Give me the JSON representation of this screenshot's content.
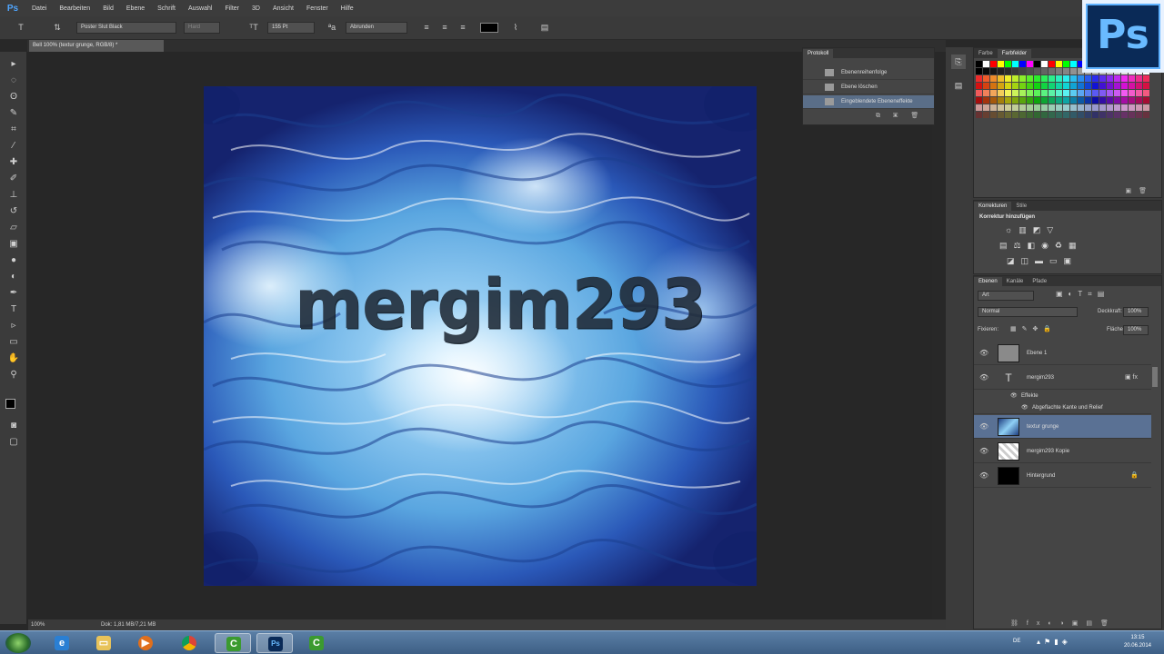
{
  "app": {
    "logo_small": "Ps",
    "logo_big": "Ps"
  },
  "menu": [
    "Datei",
    "Bearbeiten",
    "Bild",
    "Ebene",
    "Schrift",
    "Auswahl",
    "Filter",
    "3D",
    "Ansicht",
    "Fenster",
    "Hilfe"
  ],
  "options": {
    "font_family": "Poster Slut Black",
    "font_style": "Hard",
    "font_size": "155 Pt",
    "antialias": "Abrunden",
    "text_color": "#000000"
  },
  "document": {
    "tab_title": "Bell 100% (textur grunge, RGB/8) *",
    "art_text": "mergim293",
    "zoom": "100%",
    "doc_info": "Dok: 1,81 MB/7,21 MB"
  },
  "history": {
    "tab": "Protokoll",
    "items": [
      "Ebenenreihenfolge",
      "Ebene löschen",
      "Eingeblendete Ebeneneffekte"
    ]
  },
  "swatches": {
    "tabs": [
      "Farbe",
      "Farbfelder"
    ]
  },
  "adjustments": {
    "tabs": [
      "Korrekturen",
      "Stile"
    ],
    "heading": "Korrektur hinzufügen"
  },
  "layers": {
    "tabs": [
      "Ebenen",
      "Kanäle",
      "Pfade"
    ],
    "filter": "Art",
    "blend_mode": "Normal",
    "opacity_label": "Deckkraft:",
    "opacity_value": "100%",
    "lock_label": "Fixieren:",
    "fill_label": "Fläche:",
    "fill_value": "100%",
    "items": [
      {
        "name": "Ebene 1"
      },
      {
        "name": "mergim293"
      },
      {
        "name": "Effekte"
      },
      {
        "name": "Abgeflachte Kante und Relief"
      },
      {
        "name": "textur grunge"
      },
      {
        "name": "mergim293 Kopie"
      },
      {
        "name": "Hintergrund"
      }
    ]
  },
  "taskbar": {
    "time": "13:15",
    "date": "20.06.2014",
    "lang": "DE"
  }
}
